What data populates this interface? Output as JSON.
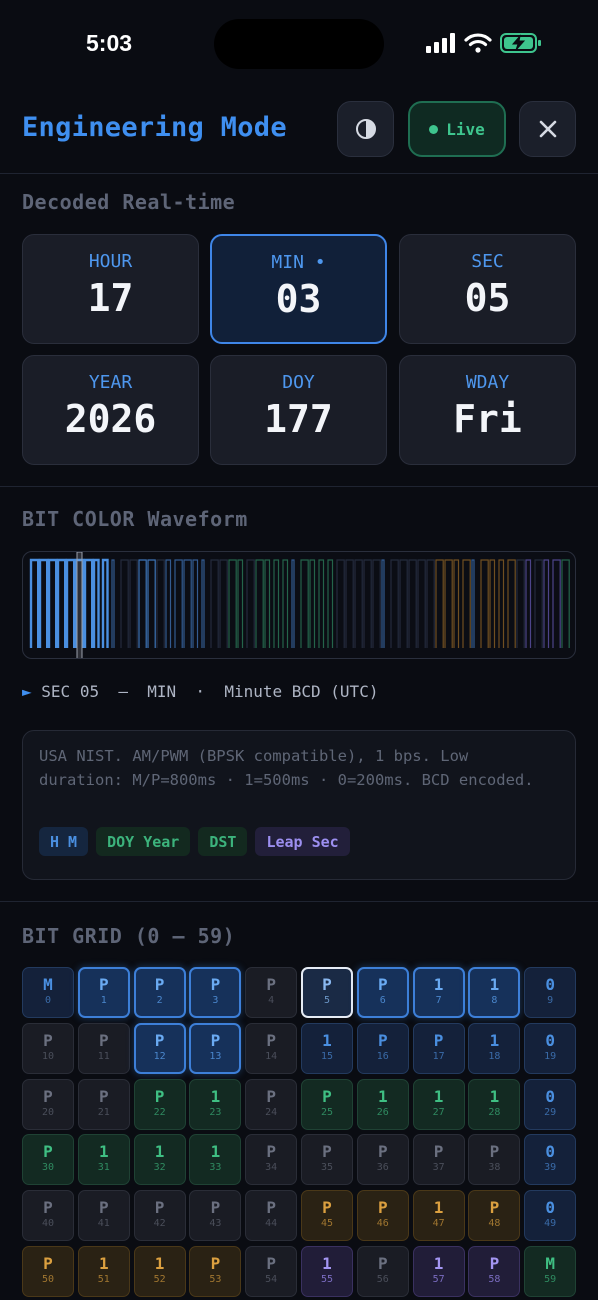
{
  "status_bar": {
    "time": "5:03"
  },
  "header": {
    "title": "Engineering Mode",
    "live_label": "Live"
  },
  "decoded": {
    "title": "Decoded Real-time",
    "cards": [
      {
        "label": "HOUR",
        "value": "17"
      },
      {
        "label": "MIN •",
        "value": "03"
      },
      {
        "label": "SEC",
        "value": "05"
      },
      {
        "label": "YEAR",
        "value": "2026"
      },
      {
        "label": "DOY",
        "value": "177"
      },
      {
        "label": "WDAY",
        "value": "Fri"
      }
    ],
    "active_index": 1
  },
  "waveform": {
    "title": "BIT COLOR Waveform",
    "readout": {
      "sec": "SEC 05",
      "field": "MIN",
      "desc": "Minute BCD (UTC)"
    },
    "cursor_second": 5,
    "info": "USA NIST. AM/PWM (BPSK compatible), 1 bps. Low duration: M/P=800ms · 1=500ms · 0=200ms. BCD encoded.",
    "tags": [
      {
        "label": "H M",
        "color": "#4a8fe0",
        "bg": "#15263f"
      },
      {
        "label": "DOY Year",
        "color": "#3cb37c",
        "bg": "#13291f"
      },
      {
        "label": "DST",
        "color": "#3cb37c",
        "bg": "#13291f"
      },
      {
        "label": "Leap Sec",
        "color": "#9c8ff0",
        "bg": "#221f3a"
      }
    ]
  },
  "bit_grid": {
    "title": "BIT GRID (0 — 59)",
    "bits": [
      "M",
      "P",
      "P",
      "P",
      "P",
      "P",
      "P",
      "1",
      "1",
      "0",
      "P",
      "P",
      "P",
      "P",
      "P",
      "1",
      "P",
      "P",
      "1",
      "0",
      "P",
      "P",
      "P",
      "1",
      "P",
      "P",
      "1",
      "1",
      "1",
      "0",
      "P",
      "1",
      "1",
      "1",
      "P",
      "P",
      "P",
      "P",
      "P",
      "0",
      "P",
      "P",
      "P",
      "P",
      "P",
      "P",
      "P",
      "1",
      "P",
      "0",
      "P",
      "1",
      "1",
      "P",
      "P",
      "1",
      "P",
      "1",
      "P",
      "M"
    ],
    "groups": [
      "b",
      "h",
      "h",
      "h",
      "n",
      "c",
      "h",
      "h",
      "h",
      "b",
      "n",
      "n",
      "h",
      "h",
      "n",
      "b",
      "b",
      "b",
      "b",
      "b",
      "n",
      "n",
      "g",
      "g",
      "n",
      "g",
      "g",
      "g",
      "g",
      "b",
      "g",
      "g",
      "g",
      "g",
      "n",
      "n",
      "n",
      "n",
      "n",
      "b",
      "n",
      "n",
      "n",
      "n",
      "n",
      "o",
      "o",
      "o",
      "o",
      "b",
      "o",
      "o",
      "o",
      "o",
      "n",
      "p",
      "n",
      "p",
      "p",
      "m"
    ],
    "current_second": 5
  },
  "colors": {
    "accent": "#3f8ff0",
    "live": "#3ec58e",
    "battery": "#3ec58e"
  }
}
